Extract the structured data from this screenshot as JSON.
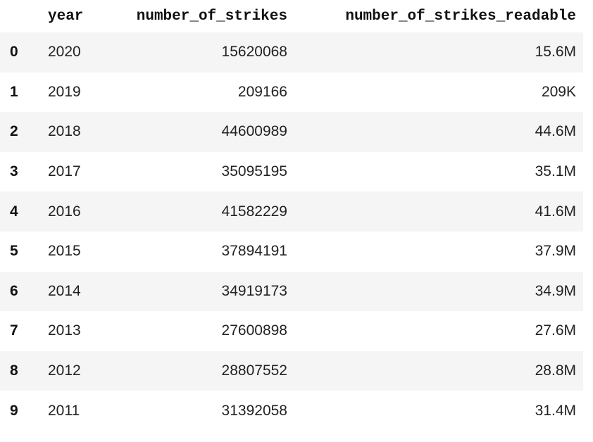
{
  "table": {
    "columns": [
      "year",
      "number_of_strikes",
      "number_of_strikes_readable"
    ],
    "rows": [
      {
        "index": "0",
        "year": "2020",
        "number_of_strikes": "15620068",
        "number_of_strikes_readable": "15.6M"
      },
      {
        "index": "1",
        "year": "2019",
        "number_of_strikes": "209166",
        "number_of_strikes_readable": "209K"
      },
      {
        "index": "2",
        "year": "2018",
        "number_of_strikes": "44600989",
        "number_of_strikes_readable": "44.6M"
      },
      {
        "index": "3",
        "year": "2017",
        "number_of_strikes": "35095195",
        "number_of_strikes_readable": "35.1M"
      },
      {
        "index": "4",
        "year": "2016",
        "number_of_strikes": "41582229",
        "number_of_strikes_readable": "41.6M"
      },
      {
        "index": "5",
        "year": "2015",
        "number_of_strikes": "37894191",
        "number_of_strikes_readable": "37.9M"
      },
      {
        "index": "6",
        "year": "2014",
        "number_of_strikes": "34919173",
        "number_of_strikes_readable": "34.9M"
      },
      {
        "index": "7",
        "year": "2013",
        "number_of_strikes": "27600898",
        "number_of_strikes_readable": "27.6M"
      },
      {
        "index": "8",
        "year": "2012",
        "number_of_strikes": "28807552",
        "number_of_strikes_readable": "28.8M"
      },
      {
        "index": "9",
        "year": "2011",
        "number_of_strikes": "31392058",
        "number_of_strikes_readable": "31.4M"
      }
    ]
  }
}
